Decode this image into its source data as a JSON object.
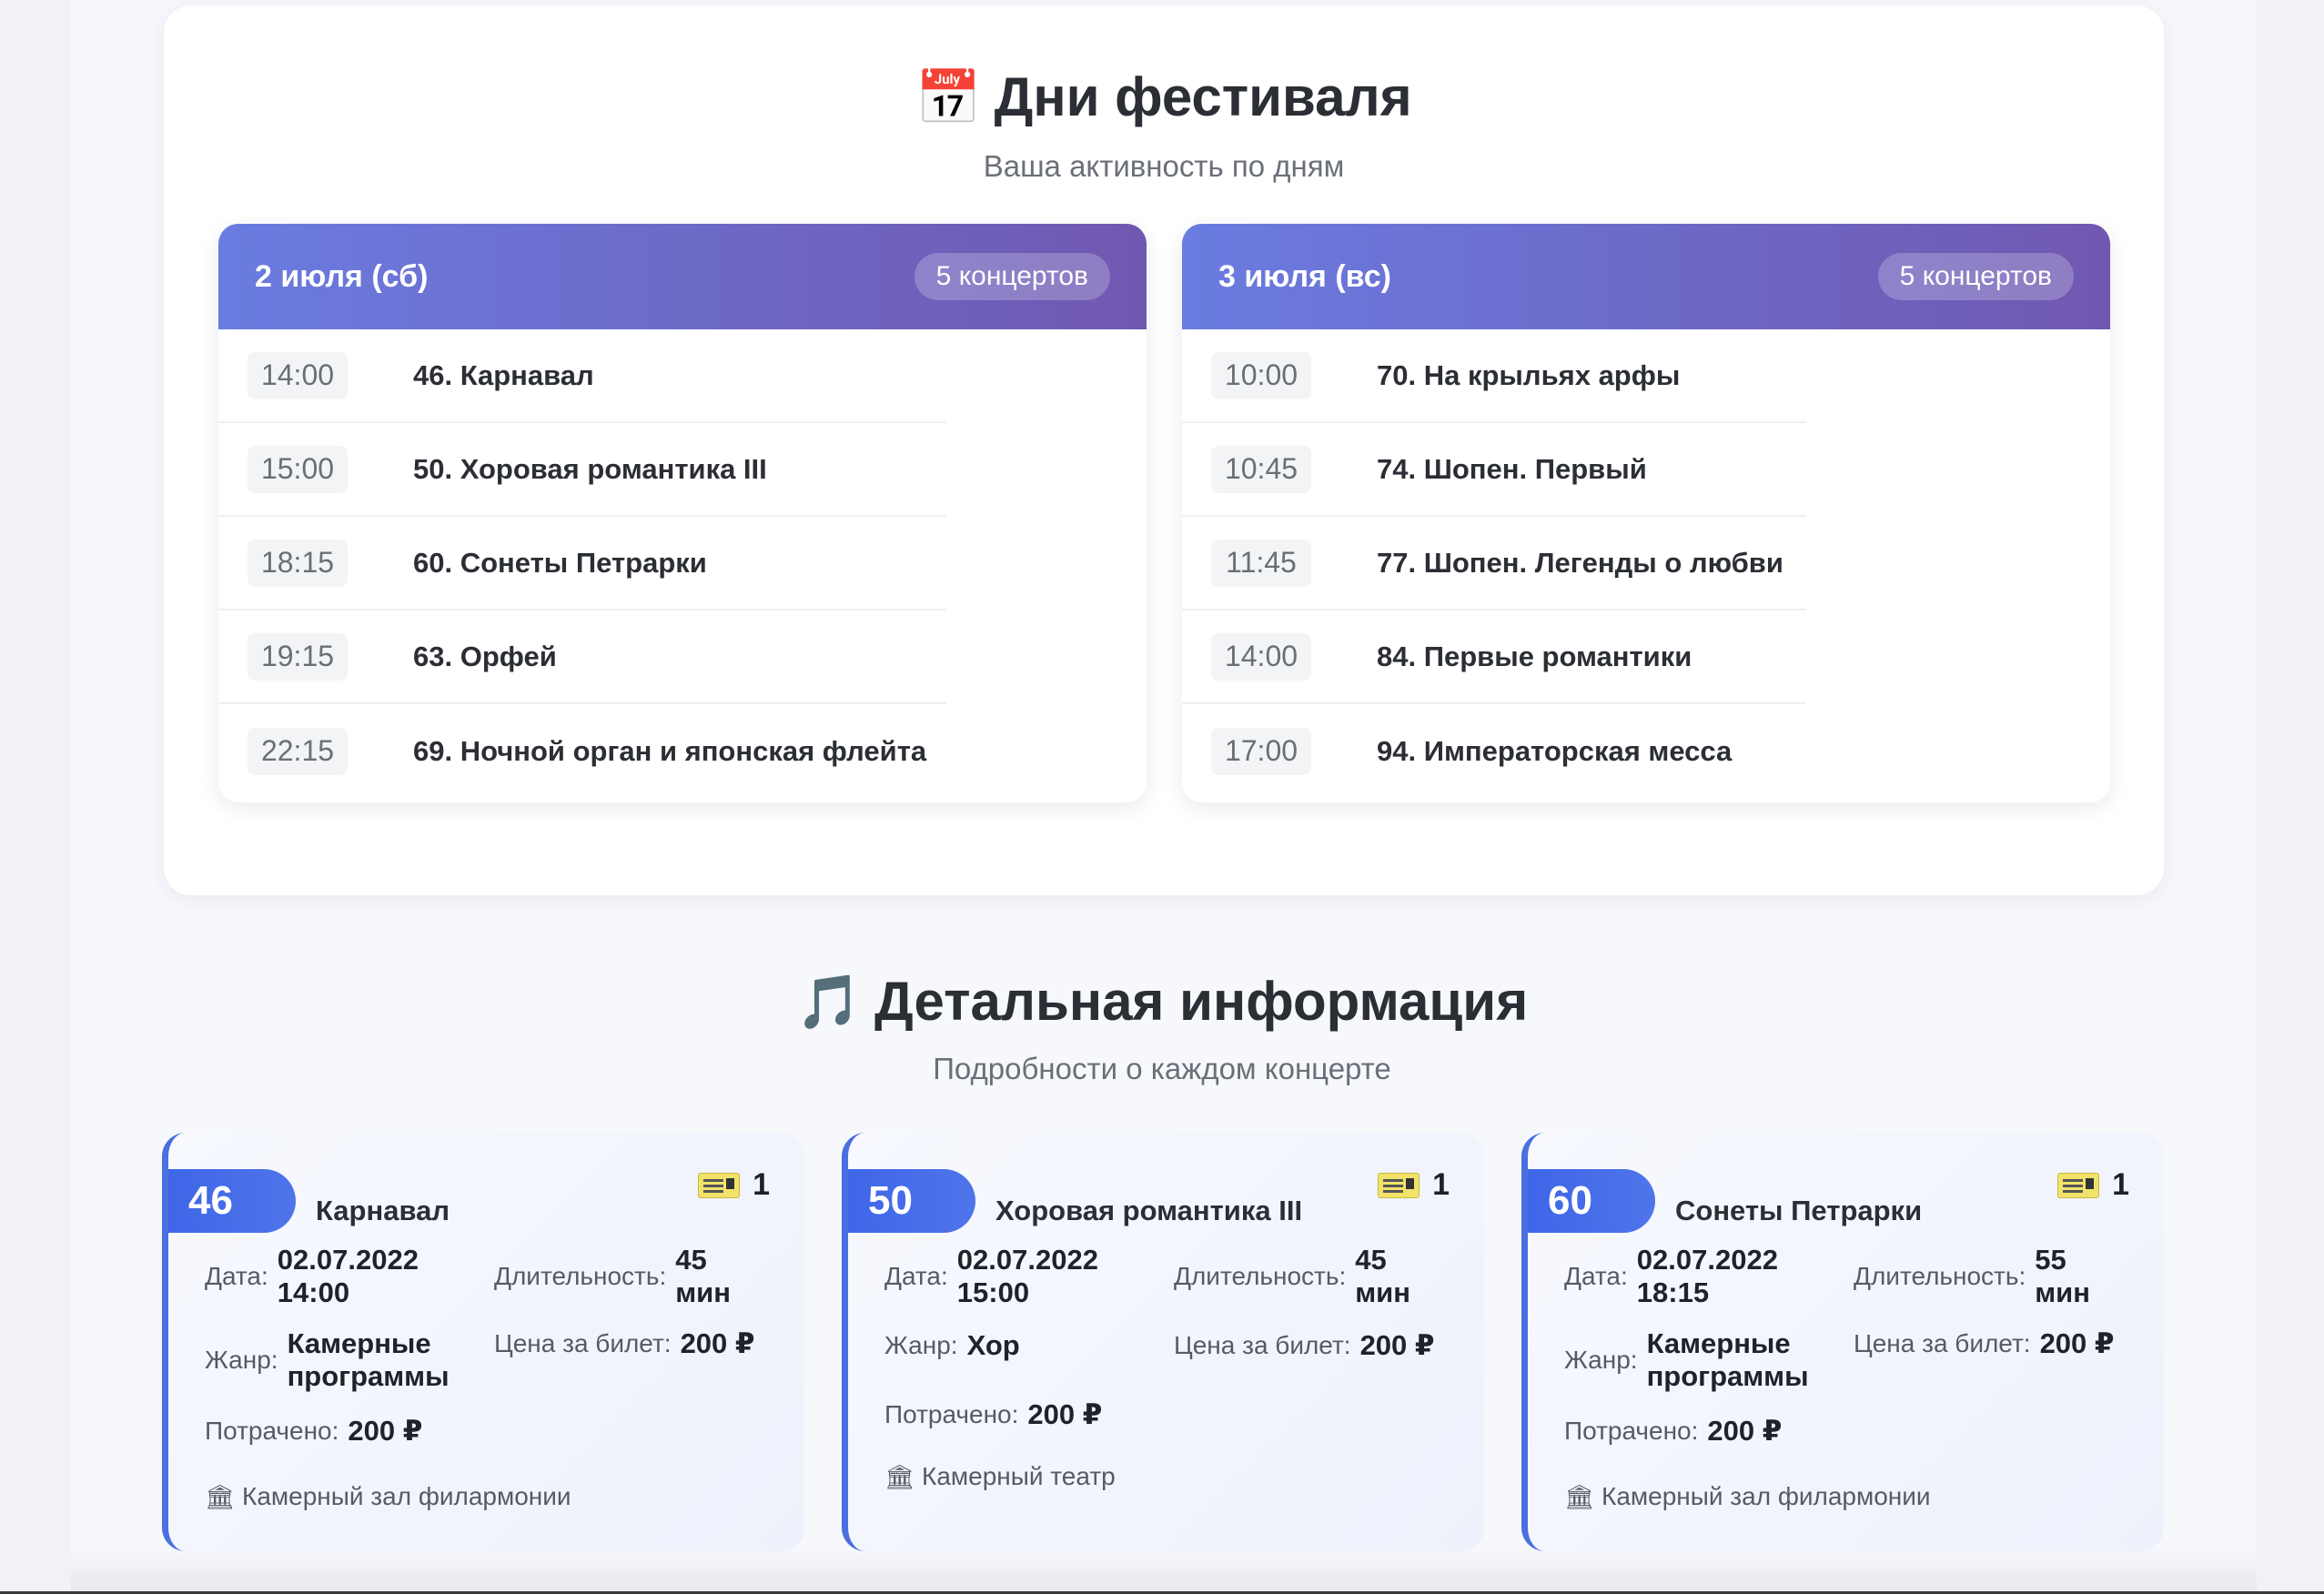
{
  "days_section": {
    "icon": "📅",
    "title": "Дни фестиваля",
    "subtitle": "Ваша активность по дням",
    "days": [
      {
        "title": "2 июля (сб)",
        "badge": "5 концертов",
        "concerts": [
          {
            "time": "14:00",
            "name": "46. Карнавал"
          },
          {
            "time": "15:00",
            "name": "50. Хоровая романтика III"
          },
          {
            "time": "18:15",
            "name": "60. Сонеты Петрарки"
          },
          {
            "time": "19:15",
            "name": "63. Орфей"
          },
          {
            "time": "22:15",
            "name": "69. Ночной орган и японская флейта"
          }
        ]
      },
      {
        "title": "3 июля (вс)",
        "badge": "5 концертов",
        "concerts": [
          {
            "time": "10:00",
            "name": "70. На крыльях арфы"
          },
          {
            "time": "10:45",
            "name": "74. Шопен. Первый"
          },
          {
            "time": "11:45",
            "name": "77. Шопен. Легенды о любви"
          },
          {
            "time": "14:00",
            "name": "84. Первые романтики"
          },
          {
            "time": "17:00",
            "name": "94. Императорская месса"
          }
        ]
      }
    ]
  },
  "details_section": {
    "icon": "🎵",
    "title": "Детальная информация",
    "subtitle": "Подробности о каждом концерте",
    "labels": {
      "date": "Дата:",
      "duration": "Длительность:",
      "genre": "Жанр:",
      "price": "Цена за билет:",
      "spent": "Потрачено:"
    },
    "cards": [
      {
        "number": "46",
        "title": "Карнавал",
        "tickets": "1",
        "date": "02.07.2022 14:00",
        "duration": "45 мин",
        "genre": "Камерные программы",
        "price": "200 ₽",
        "spent": "200 ₽",
        "venue": "Камерный зал филармонии"
      },
      {
        "number": "50",
        "title": "Хоровая романтика III",
        "tickets": "1",
        "date": "02.07.2022 15:00",
        "duration": "45 мин",
        "genre": "Хор",
        "price": "200 ₽",
        "spent": "200 ₽",
        "venue": "Камерный театр"
      },
      {
        "number": "60",
        "title": "Сонеты Петрарки",
        "tickets": "1",
        "date": "02.07.2022 18:15",
        "duration": "55 мин",
        "genre": "Камерные программы",
        "price": "200 ₽",
        "spent": "200 ₽",
        "venue": "Камерный зал филармонии"
      }
    ]
  },
  "colors": {
    "day_header_start": "#6a7ce0",
    "day_header_end": "#7058b0",
    "badge_blue": "#3f66e8",
    "card_accent": "#4a6fe0"
  },
  "icons": {
    "venue": "🏛",
    "ticket": "ticket-icon"
  }
}
